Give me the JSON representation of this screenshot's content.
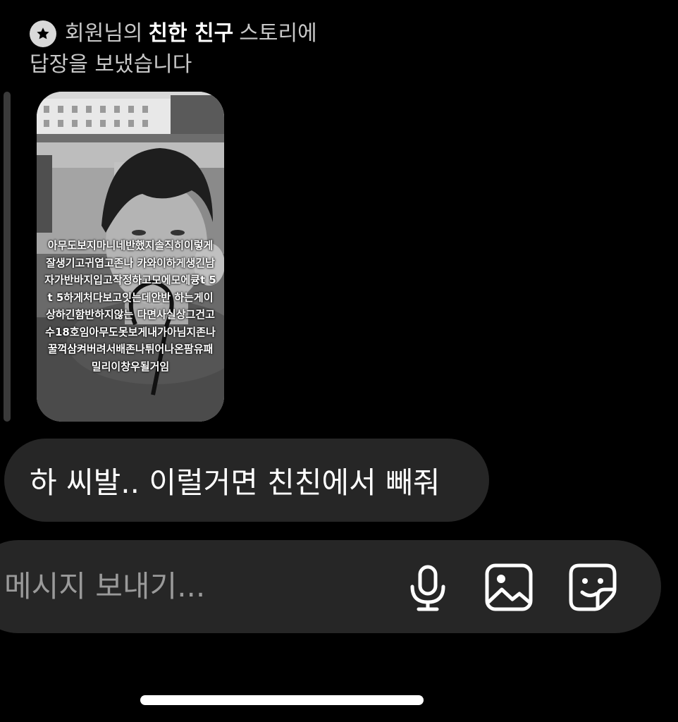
{
  "reply_header": {
    "prefix": "회원님의",
    "bold": "친한 친구",
    "suffix": "스토리에",
    "line2": "답장을 보냈습니다"
  },
  "story": {
    "overlay_text": "아무도보지마니네반했지솔직히이렇게잘생기고귀엽고존나 카와이하게생긴남자가반바지입고작정하고모에모에큥t 5 t 5하게처다보고잇는데안반 하는게이상하긴함반하지않는 다면사실상그건고수18호임아무도못보게내가아님지존나꿀꺽삼켜버려서배존나튀어나온팜유패밀리이창우될거임"
  },
  "message": {
    "text": "하 씨발.. 이럴거면 친친에서 빼줘"
  },
  "composer": {
    "placeholder": "메시지 보내기...",
    "icons": [
      "microphone-icon",
      "image-icon",
      "sticker-icon"
    ]
  }
}
